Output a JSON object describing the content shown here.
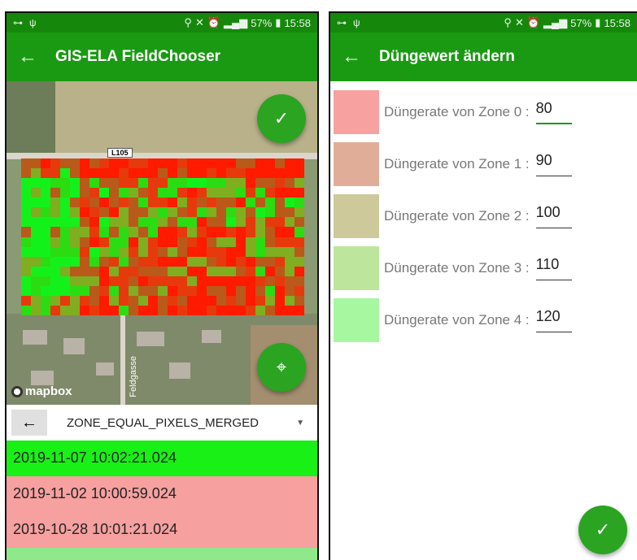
{
  "status_bar": {
    "battery": "57%",
    "time": "15:58"
  },
  "left_screen": {
    "app_bar": {
      "back_icon": "arrow-left-icon",
      "title": "GIS-ELA FieldChooser"
    },
    "map": {
      "road_label": "L105",
      "street_label": "Feldgasse",
      "attribution": "mapbox"
    },
    "selector": {
      "value": "ZONE_EQUAL_PIXELS_MERGED"
    },
    "dates": [
      {
        "text": "2019-11-07 10:02:21.024",
        "color": "#18f016"
      },
      {
        "text": "2019-11-02 10:00:59.024",
        "color": "#f6a0a0"
      },
      {
        "text": "2019-10-28 10:01:21.024",
        "color": "#f6a0a0"
      }
    ]
  },
  "right_screen": {
    "app_bar": {
      "back_icon": "arrow-left-icon",
      "title": "Düngewert ändern"
    },
    "zones": [
      {
        "label": "Düngerate von Zone 0 :",
        "value": "80",
        "color": "#f7a1a1"
      },
      {
        "label": "Düngerate von Zone 1 :",
        "value": "90",
        "color": "#e0ae98"
      },
      {
        "label": "Düngerate von Zone 2 :",
        "value": "100",
        "color": "#cdc99a"
      },
      {
        "label": "Düngerate von Zone 3 :",
        "value": "110",
        "color": "#bde69c"
      },
      {
        "label": "Düngerate von Zone 4 :",
        "value": "120",
        "color": "#a6f7a0"
      }
    ]
  }
}
